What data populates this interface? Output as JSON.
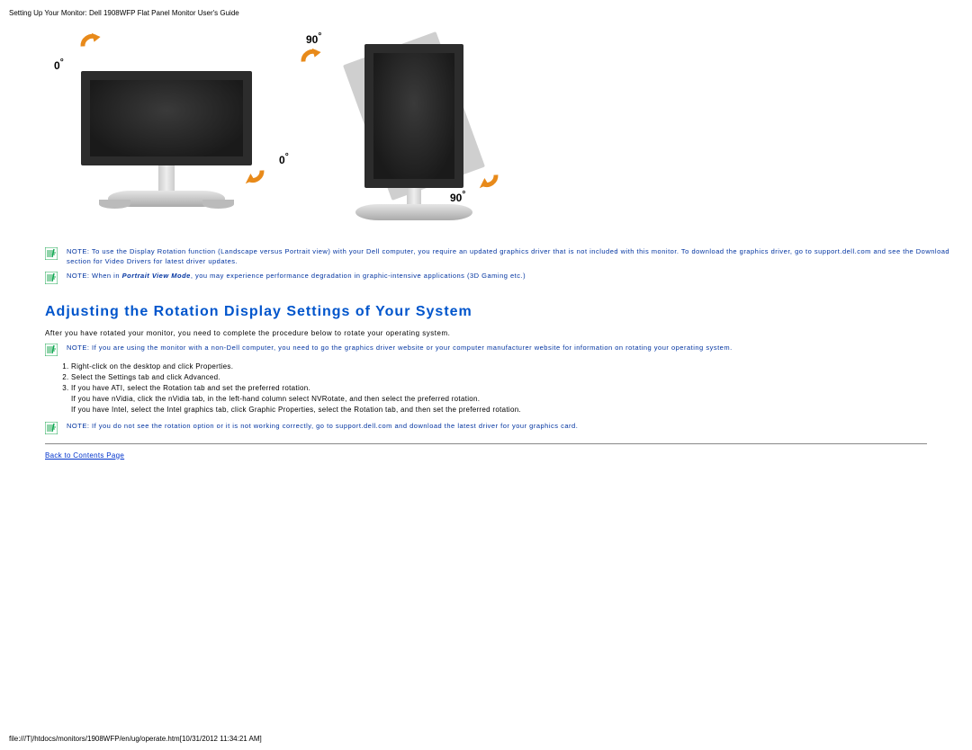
{
  "header": "Setting Up Your Monitor: Dell 1908WFP Flat Panel Monitor User's Guide",
  "diagram": {
    "label_0_a": "0",
    "label_0_b": "0",
    "label_90_a": "90",
    "label_90_b": "90",
    "deg": "°"
  },
  "notes": {
    "n1_pre": "NOTE: To use the Display Rotation function (Landscape versus Portrait view) with your Dell computer, you require an updated graphics driver that is not included with this monitor. To download the graphics driver, go to support.dell.com and see the Download section for Video Drivers for latest driver updates.",
    "n2_pre": "NOTE: When in",
    "n2_italic": "Portrait View Mode",
    "n2_post": ", you may experience performance degradation in graphic-intensive applications (3D Gaming etc.)",
    "n3": "NOTE: If you are using the monitor with a non-Dell computer, you need to go the graphics driver website or your computer manufacturer website for information on rotating your operating system.",
    "n4": "NOTE: If you do not see the rotation option or it is not working correctly, go to support.dell.com and download the latest driver for your graphics card."
  },
  "heading": "Adjusting the Rotation Display Settings of Your System",
  "intro": "After you have rotated your monitor, you need to complete the procedure below to rotate your operating system.",
  "steps": {
    "s1": "Right-click on the desktop and click Properties.",
    "s2": "Select the Settings tab and click Advanced.",
    "s3": "If you have ATI, select the Rotation tab and set the preferred rotation.",
    "s3b": "If you have nVidia, click the nVidia tab, in the left-hand column select NVRotate, and then select the preferred rotation.",
    "s3c": "If you have Intel, select the Intel graphics tab, click Graphic Properties, select the Rotation tab, and then set the preferred rotation."
  },
  "back_link": "Back to Contents Page",
  "footer": "file:///T|/htdocs/monitors/1908WFP/en/ug/operate.htm[10/31/2012 11:34:21 AM]"
}
